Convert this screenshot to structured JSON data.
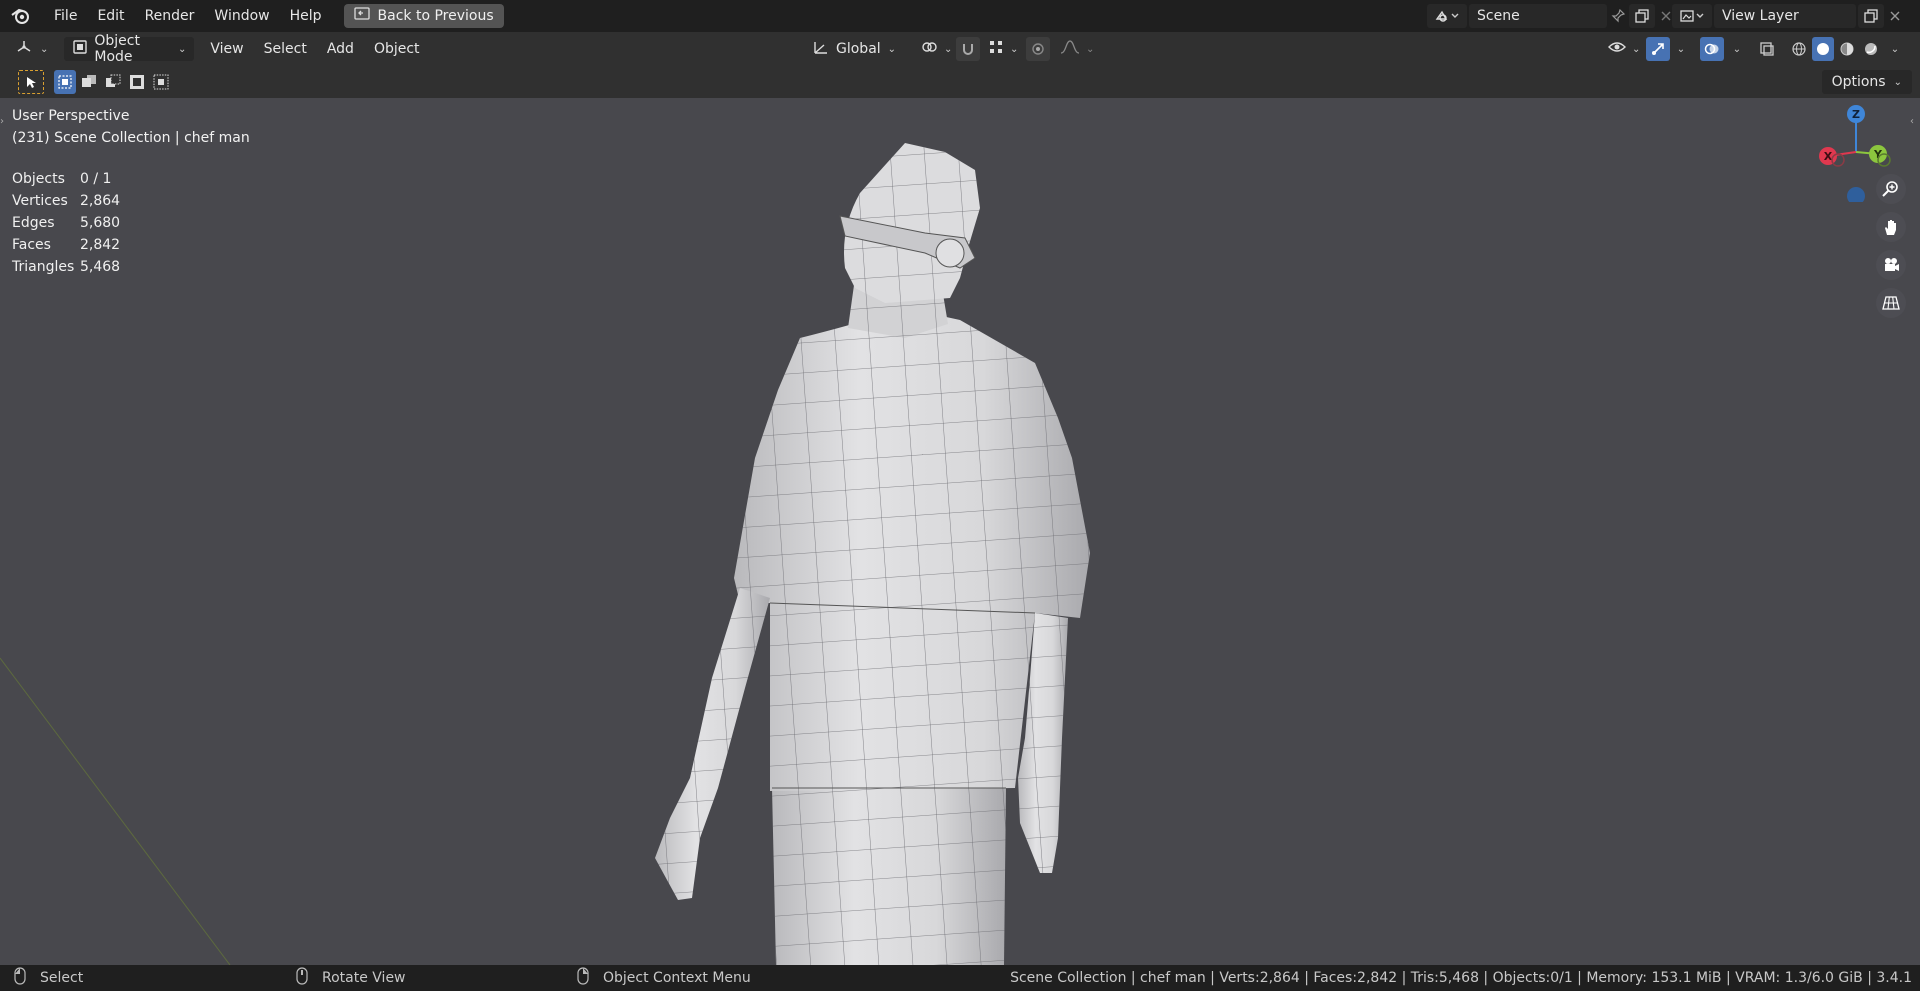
{
  "menu": {
    "items": [
      "File",
      "Edit",
      "Render",
      "Window",
      "Help"
    ],
    "back_button": "Back to Previous"
  },
  "scene": {
    "name": "Scene"
  },
  "view_layer": {
    "name": "View Layer"
  },
  "header": {
    "mode": "Object Mode",
    "view": "View",
    "select": "Select",
    "add": "Add",
    "object": "Object",
    "transform_orientation": "Global"
  },
  "toolheader": {
    "options": "Options"
  },
  "viewport": {
    "perspective": "User Perspective",
    "collection": "(231) Scene Collection | chef man",
    "stats": [
      {
        "label": "Objects",
        "value": "0 / 1"
      },
      {
        "label": "Vertices",
        "value": "2,864"
      },
      {
        "label": "Edges",
        "value": "5,680"
      },
      {
        "label": "Faces",
        "value": "2,842"
      },
      {
        "label": "Triangles",
        "value": "5,468"
      }
    ],
    "gizmo": {
      "x": "X",
      "y": "Y",
      "z": "Z"
    }
  },
  "statusbar": {
    "select": "Select",
    "rotate": "Rotate View",
    "context": "Object Context Menu",
    "info": "Scene Collection | chef man | Verts:2,864 | Faces:2,842 | Tris:5,468 | Objects:0/1 | Memory: 153.1 MiB | VRAM: 1.3/6.0 GiB | 3.4.1"
  },
  "colors": {
    "viewport_bg": "#48484d",
    "accent_blue": "#4772b3",
    "axis_x": "#e0384f",
    "axis_y": "#8cc63e",
    "axis_z": "#3f86d8"
  }
}
